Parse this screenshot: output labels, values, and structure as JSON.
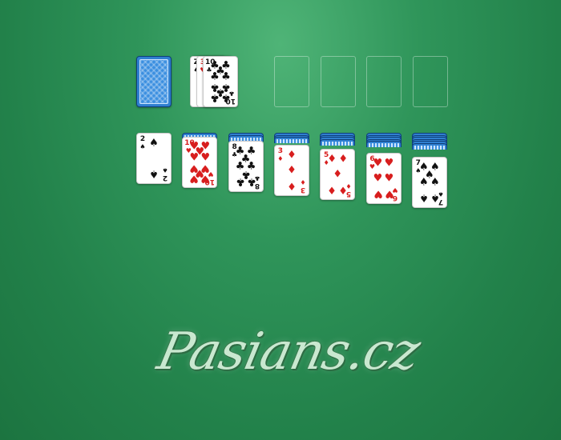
{
  "logo": {
    "text": "Pasians.cz"
  },
  "stock": {
    "face": "down"
  },
  "waste": {
    "cards": [
      {
        "rank": "Z",
        "suit": "♠",
        "color": "black"
      },
      {
        "rank": "3",
        "suit": "♥",
        "color": "red"
      },
      {
        "rank": "10",
        "suit": "♣",
        "color": "black"
      }
    ]
  },
  "foundations": [
    {},
    {},
    {},
    {}
  ],
  "tableau": [
    {
      "hidden": 0,
      "top": {
        "rank": "2",
        "suit": "♠",
        "color": "black"
      }
    },
    {
      "hidden": 1,
      "top": {
        "rank": "10",
        "suit": "♥",
        "color": "red"
      }
    },
    {
      "hidden": 2,
      "top": {
        "rank": "8",
        "suit": "♣",
        "color": "black"
      }
    },
    {
      "hidden": 3,
      "top": {
        "rank": "3",
        "suit": "♦",
        "color": "red"
      }
    },
    {
      "hidden": 4,
      "top": {
        "rank": "5",
        "suit": "♦",
        "color": "red"
      }
    },
    {
      "hidden": 5,
      "top": {
        "rank": "6",
        "suit": "♥",
        "color": "red"
      }
    },
    {
      "hidden": 6,
      "top": {
        "rank": "7",
        "suit": "♠",
        "color": "black"
      }
    }
  ]
}
